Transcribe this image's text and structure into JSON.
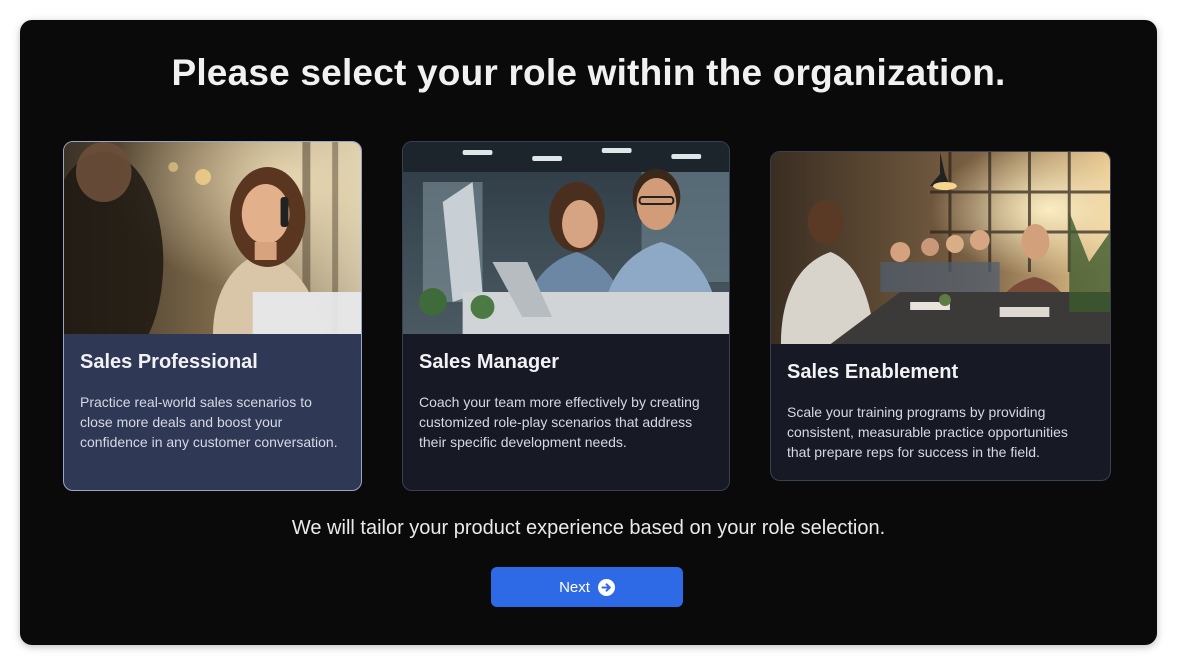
{
  "page": {
    "title": "Please select your role within the organization.",
    "subtitle": "We will tailor your product experience based on your role selection."
  },
  "roles": [
    {
      "title": "Sales Professional",
      "description": "Practice real-world sales scenarios to close more deals and boost your confidence in any customer conversation.",
      "selected": true,
      "image": "woman-on-phone-photo"
    },
    {
      "title": "Sales Manager",
      "description": "Coach your team more effectively by creating customized role-play scenarios that address their specific development needs.",
      "selected": false,
      "image": "two-colleagues-at-laptop-photo"
    },
    {
      "title": "Sales Enablement",
      "description": "Scale your training programs by providing consistent, measurable practice opportunities that prepare reps for success in the field.",
      "selected": false,
      "image": "team-meeting-photo"
    }
  ],
  "next_button": {
    "label": "Next",
    "icon": "arrow-right-circle-icon"
  },
  "colors": {
    "background": "#0a0a0a",
    "selected_card": "#2f3956",
    "card": "#171a24",
    "accent": "#2f6ae6"
  }
}
